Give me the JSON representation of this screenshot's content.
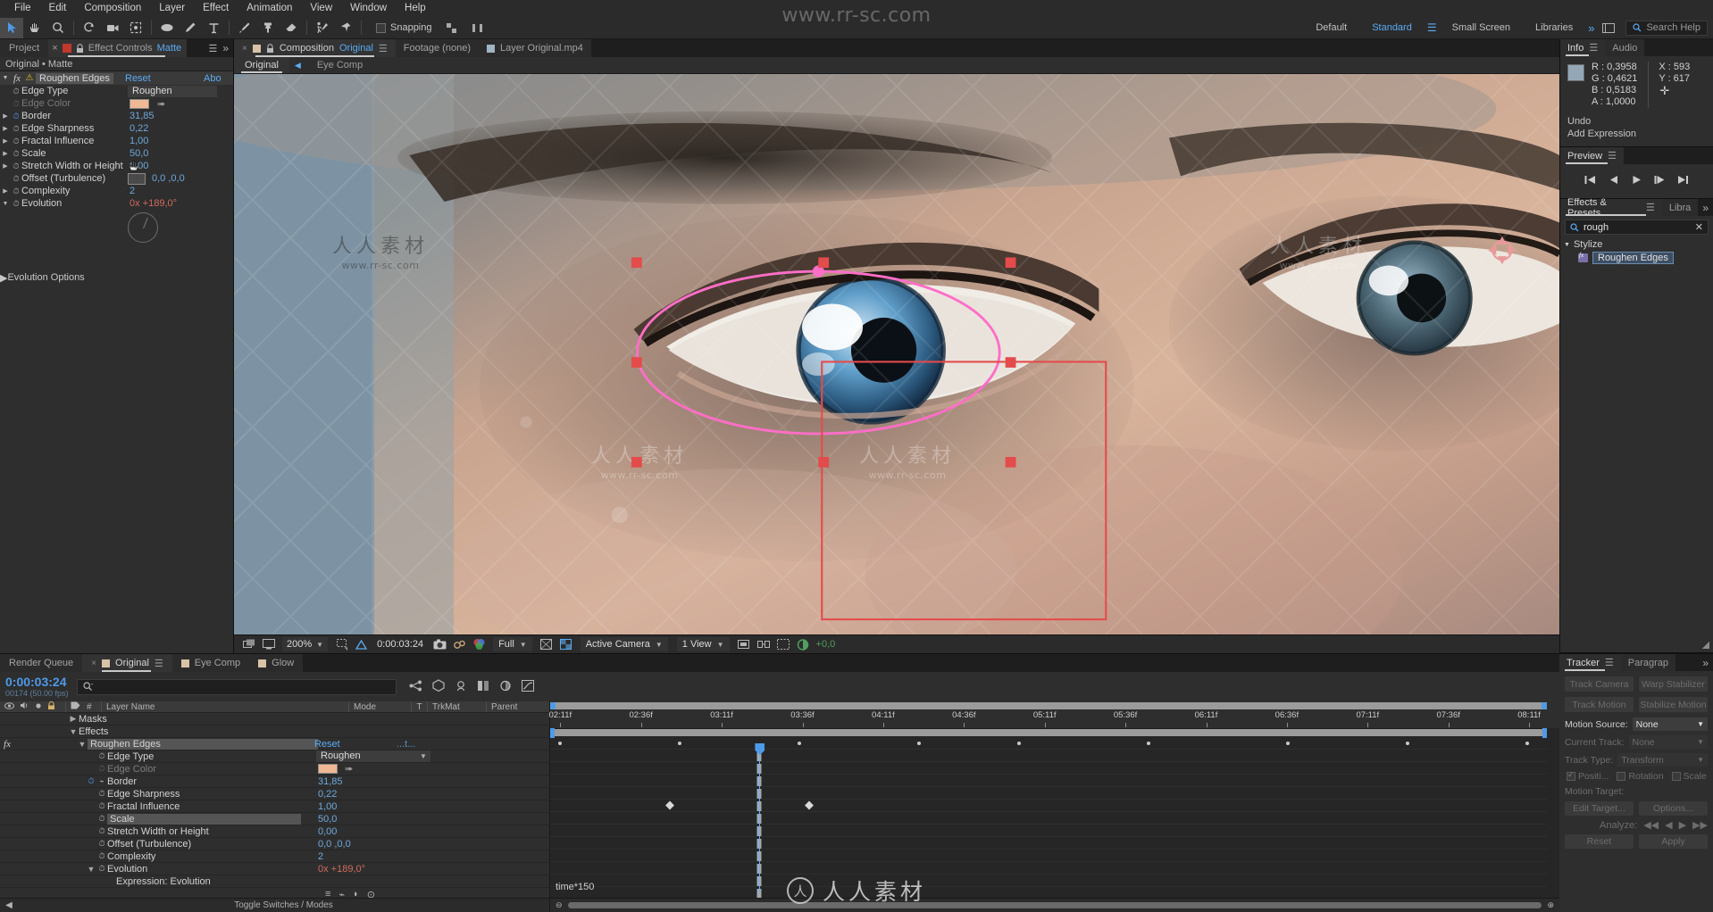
{
  "menubar": [
    "File",
    "Edit",
    "Composition",
    "Layer",
    "Effect",
    "Animation",
    "View",
    "Window",
    "Help"
  ],
  "toolbar": {
    "snapping_label": "Snapping",
    "watermark": "www.rr-sc.com",
    "workspaces": [
      "Default",
      "Standard",
      "Small Screen",
      "Libraries"
    ],
    "selected_workspace": "Standard",
    "search_help_placeholder": "Search Help"
  },
  "effect_controls": {
    "tab_project": "Project",
    "tab_title": "Effect Controls",
    "tab_target": "Matte",
    "breadcrumb": "Original • Matte",
    "effect_name": "Roughen Edges",
    "reset_label": "Reset",
    "about_label": "Abo",
    "properties": [
      {
        "label": "Edge Type",
        "value": "Roughen",
        "type": "dropdown",
        "expand": false,
        "stopwatch": true
      },
      {
        "label": "Edge Color",
        "value": "",
        "type": "color",
        "expand": false,
        "stopwatch": true,
        "dim": true
      },
      {
        "label": "Border",
        "value": "31,85",
        "type": "number",
        "expand": true,
        "stopwatch": true,
        "animated": true
      },
      {
        "label": "Edge Sharpness",
        "value": "0,22",
        "type": "number",
        "expand": true,
        "stopwatch": true
      },
      {
        "label": "Fractal Influence",
        "value": "1,00",
        "type": "number",
        "expand": true,
        "stopwatch": true
      },
      {
        "label": "Scale",
        "value": "50,0",
        "type": "number",
        "expand": true,
        "stopwatch": true
      },
      {
        "label": "Stretch Width or Height",
        "value": "0,00",
        "type": "number",
        "expand": true,
        "stopwatch": true
      },
      {
        "label": "Offset (Turbulence)",
        "value": "0,0 ,0,0",
        "type": "point",
        "expand": false,
        "stopwatch": true
      },
      {
        "label": "Complexity",
        "value": "2",
        "type": "number",
        "expand": true,
        "stopwatch": true
      },
      {
        "label": "Evolution",
        "value": "0x +189,0°",
        "type": "angle",
        "expand": true,
        "stopwatch": true
      }
    ],
    "evolution_options": "Evolution Options"
  },
  "composition": {
    "tabs": [
      {
        "label": "Composition",
        "highlight": "Original",
        "kind": "comp",
        "selected": true
      },
      {
        "label": "Footage (none)",
        "kind": "footage",
        "selected": false
      },
      {
        "label": "Layer Original.mp4",
        "kind": "layer",
        "selected": false
      }
    ],
    "sub_tabs": [
      "Original",
      "Eye Comp"
    ],
    "sub_selected": "Original",
    "viewer_bar": {
      "zoom": "200%",
      "timecode": "0:00:03:24",
      "resolution": "Full",
      "camera": "Active Camera",
      "views": "1 View",
      "exposure": "+0,0"
    }
  },
  "info_panel": {
    "tab_info": "Info",
    "tab_audio": "Audio",
    "R": "R : 0,3958",
    "G": "G : 0,4621",
    "B": "B : 0,5183",
    "A": "A : 1,0000",
    "X": "X : 593",
    "Y": "Y : 617",
    "line1": "Undo",
    "line2": "Add Expression"
  },
  "preview_panel": {
    "title": "Preview"
  },
  "effects_presets": {
    "title": "Effects & Presets",
    "tab2": "Libra",
    "search_value": "rough",
    "group": "Stylize",
    "item": "Roughen Edges"
  },
  "timeline": {
    "tabs": [
      {
        "label": "Render Queue",
        "selected": false,
        "has_square": false
      },
      {
        "label": "Original",
        "selected": true,
        "has_square": true
      },
      {
        "label": "Eye Comp",
        "selected": false,
        "has_square": true
      },
      {
        "label": "Glow",
        "selected": false,
        "has_square": true
      }
    ],
    "current_time": "0:00:03:24",
    "frame_info": "00174 (50.00 fps)",
    "columns": [
      "#",
      "Layer Name",
      "Mode",
      "T",
      "TrkMat",
      "Parent"
    ],
    "rows": [
      {
        "indent": 1,
        "tri": "▶",
        "label": "Masks",
        "kind": "group"
      },
      {
        "indent": 1,
        "tri": "▼",
        "label": "Effects",
        "kind": "group"
      },
      {
        "indent": 2,
        "tri": "▼",
        "label": "Roughen Edges",
        "kind": "effect",
        "fx": true,
        "highlight": true,
        "reset": "Reset",
        "dots": "...t..."
      },
      {
        "indent": 3,
        "tri": "",
        "label": "Edge Type",
        "kind": "dropdown",
        "value": "Roughen",
        "stopwatch": true
      },
      {
        "indent": 3,
        "tri": "",
        "label": "Edge Color",
        "kind": "color",
        "value": "",
        "stopwatch": true,
        "dim": true
      },
      {
        "indent": 3,
        "tri": "",
        "label": "Border",
        "kind": "number",
        "value": "31,85",
        "stopwatch": true,
        "animated": true
      },
      {
        "indent": 3,
        "tri": "",
        "label": "Edge Sharpness",
        "kind": "number",
        "value": "0,22",
        "stopwatch": true
      },
      {
        "indent": 3,
        "tri": "",
        "label": "Fractal Influence",
        "kind": "number",
        "value": "1,00",
        "stopwatch": true
      },
      {
        "indent": 3,
        "tri": "",
        "label": "Scale",
        "kind": "number",
        "value": "50,0",
        "stopwatch": true,
        "highlight": true
      },
      {
        "indent": 3,
        "tri": "",
        "label": "Stretch Width or Height",
        "kind": "number",
        "value": "0,00",
        "stopwatch": true
      },
      {
        "indent": 3,
        "tri": "",
        "label": "Offset (Turbulence)",
        "kind": "point",
        "value": "0,0 ,0,0",
        "stopwatch": true
      },
      {
        "indent": 3,
        "tri": "",
        "label": "Complexity",
        "kind": "number",
        "value": "2",
        "stopwatch": true
      },
      {
        "indent": 3,
        "tri": "▼",
        "label": "Evolution",
        "kind": "angle",
        "value": "0x +189,0°",
        "stopwatch": true,
        "red": true
      },
      {
        "indent": 4,
        "tri": "",
        "label": "Expression: Evolution",
        "kind": "expression"
      }
    ],
    "ruler_ticks": [
      "02:11f",
      "02:36f",
      "03:11f",
      "03:36f",
      "04:11f",
      "04:36f",
      "05:11f",
      "05:36f",
      "06:11f",
      "06:36f",
      "07:11f",
      "07:36f",
      "08:11f"
    ],
    "footer": "Toggle Switches / Modes",
    "time_label": "time*150"
  },
  "tracker": {
    "tab_title": "Tracker",
    "tab2": "Paragrap",
    "buttons": [
      "Track Camera",
      "Warp Stabilizer",
      "Track Motion",
      "Stabilize Motion"
    ],
    "motion_source_label": "Motion Source:",
    "motion_source_value": "None",
    "current_track_label": "Current Track:",
    "current_track_value": "None",
    "track_type_label": "Track Type:",
    "track_type_value": "Transform",
    "checks": [
      {
        "label": "Positi...",
        "on": true
      },
      {
        "label": "Rotation",
        "on": false
      },
      {
        "label": "Scale",
        "on": false
      }
    ],
    "motion_target_label": "Motion Target:",
    "edit_target": "Edit Target...",
    "options": "Options...",
    "analyze_label": "Analyze:",
    "reset": "Reset",
    "apply": "Apply"
  },
  "colors": {
    "accent_blue": "#5babf2",
    "value_blue": "#6fa8dc",
    "expression_red": "#d06a5c",
    "panel_bg": "#2e2e2e",
    "tab_bg": "#2b2b2b",
    "mask_pink": "#ff6ec7",
    "swatch_peach": "#f0b894"
  }
}
